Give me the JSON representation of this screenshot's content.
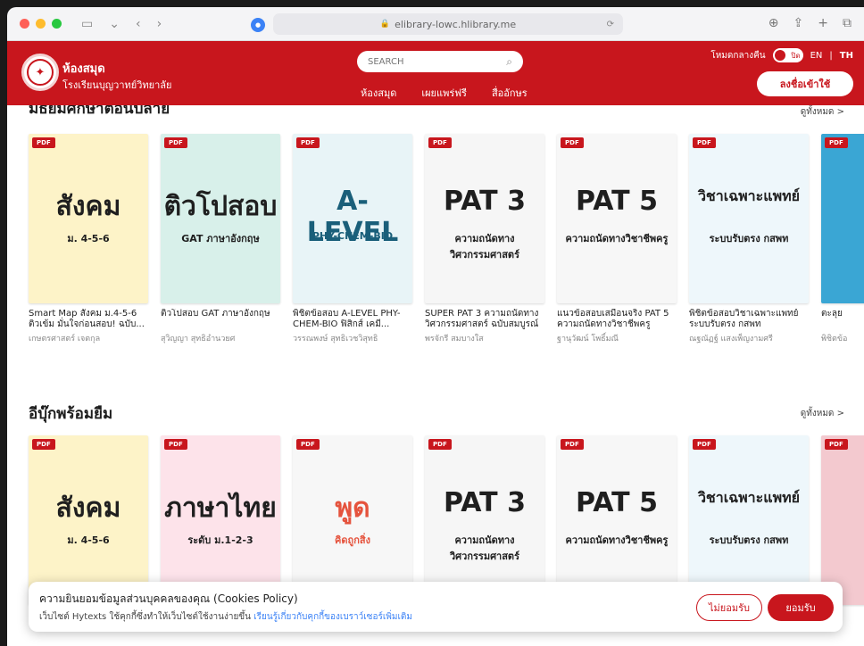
{
  "browser": {
    "url": "elibrary-lowc.hlibrary.me"
  },
  "header": {
    "title": "ห้องสมุด",
    "subtitle": "โรงเรียนบุญวาทย์วิทยาลัย",
    "search_placeholder": "SEARCH",
    "nav": [
      "ห้องสมุด",
      "เผยแพร่ฟรี",
      "สื่ออักษร"
    ],
    "dark_mode_label": "โหมดกลางคืน",
    "toggle_label": "ปิด",
    "lang_en": "EN",
    "lang_sep": "|",
    "lang_th": "TH",
    "login_label": "ลงชื่อเข้าใช้",
    "accent": "#c8161d"
  },
  "sections": [
    {
      "title": "มัธยมศึกษาตอนปลาย",
      "see_all": "ดูทั้งหมด >",
      "books": [
        {
          "title": "Smart Map สังคม ม.4-5-6 ติวเข้ม มั่นใจก่อนสอบ! ฉบับ...",
          "author": "เกษตรศาสตร์ เจตกุล",
          "cover_text": "สังคม",
          "cover_sub": "ม. 4-5-6",
          "bg": "#fdf3c8",
          "fg": "#1f1f1f"
        },
        {
          "title": "ติวโปสอบ GAT ภาษาอังกฤษ",
          "author": "สุวิญญา สุทธิอำนวยศ",
          "cover_text": "ติวโปสอบ",
          "cover_sub": "GAT ภาษาอังกฤษ",
          "bg": "#d8f0ea",
          "fg": "#1f1f1f"
        },
        {
          "title": "พิชิตข้อสอบ A-LEVEL PHY-CHEM-BIO ฟิสิกส์ เคมี...",
          "author": "วรรณพงษ์ สุทธิเวชวิสุทธิ",
          "cover_text": "A-LEVEL",
          "cover_sub": "PHY-CHEM-BIO",
          "bg": "#e8f4f7",
          "fg": "#1a5f7a"
        },
        {
          "title": "SUPER PAT 3 ความถนัดทางวิศวกรรมศาสตร์ ฉบับสมบูรณ์",
          "author": "พรจักรี สมบางใส",
          "cover_text": "PAT 3",
          "cover_sub": "ความถนัดทางวิศวกรรมศาสตร์",
          "bg": "#f6f6f6",
          "fg": "#1f1f1f"
        },
        {
          "title": "แนวข้อสอบเสมือนจริง PAT 5 ความถนัดทางวิชาชีพครู",
          "author": "ฐานุวัฒน์ โพธิ์มณี",
          "cover_text": "PAT 5",
          "cover_sub": "ความถนัดทางวิชาชีพครู",
          "bg": "#f7f7f7",
          "fg": "#1f1f1f"
        },
        {
          "title": "พิชิตข้อสอบวิชาเฉพาะแพทย์ ระบบรับตรง กสพท",
          "author": "ณฐณัฏฐ์ แสงเพ็ญงามศรี",
          "cover_text": "วิชาเฉพาะแพทย์",
          "cover_sub": "ระบบรับตรง กสพท",
          "bg": "#eef7fb",
          "fg": "#1f1f1f"
        },
        {
          "title": "ตะลุย",
          "author": "พิชิตข้อ",
          "cover_text": "",
          "cover_sub": "",
          "bg": "#3aa6d4",
          "fg": "#fff"
        }
      ]
    },
    {
      "title": "อีบุ๊กพร้อมยืม",
      "see_all": "ดูทั้งหมด >",
      "books": [
        {
          "title": "",
          "author": "",
          "cover_text": "สังคม",
          "cover_sub": "ม. 4-5-6",
          "bg": "#fdf3c8",
          "fg": "#1f1f1f"
        },
        {
          "title": "",
          "author": "",
          "cover_text": "ภาษาไทย",
          "cover_sub": "ระดับ ม.1-2-3",
          "bg": "#fde3ea",
          "fg": "#1f1f1f"
        },
        {
          "title": "",
          "author": "",
          "cover_text": "พูด",
          "cover_sub": "คิดถูกสิ่ง",
          "bg": "#f7f7f7",
          "fg": "#e5533d"
        },
        {
          "title": "",
          "author": "",
          "cover_text": "PAT 3",
          "cover_sub": "ความถนัดทางวิศวกรรมศาสตร์",
          "bg": "#f6f6f6",
          "fg": "#1f1f1f"
        },
        {
          "title": "",
          "author": "",
          "cover_text": "PAT 5",
          "cover_sub": "ความถนัดทางวิชาชีพครู",
          "bg": "#f7f7f7",
          "fg": "#1f1f1f"
        },
        {
          "title": "",
          "author": "",
          "cover_text": "วิชาเฉพาะแพทย์",
          "cover_sub": "ระบบรับตรง กสพท",
          "bg": "#eef7fb",
          "fg": "#1f1f1f"
        },
        {
          "title": "",
          "author": "",
          "cover_text": "",
          "cover_sub": "",
          "bg": "#f3c9cf",
          "fg": "#fff"
        }
      ]
    }
  ],
  "badge": "PDF",
  "cookie": {
    "title": "ความยินยอมข้อมูลส่วนบุคคลของคุณ (Cookies Policy)",
    "text": "เว็บไซต์ Hytexts ใช้คุกกี้ซึ่งทำให้เว็บไซต์ใช้งานง่ายขึ้น",
    "link": "เรียนรู้เกี่ยวกับคุกกี้ของเบราว์เซอร์เพิ่มเติม",
    "decline": "ไม่ยอมรับ",
    "accept": "ยอมรับ"
  }
}
